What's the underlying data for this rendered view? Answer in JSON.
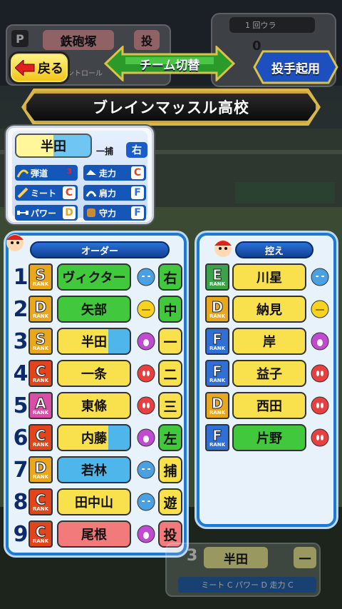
{
  "scoreboard_left": {
    "pos_badge": "P",
    "name": "鉄砲塚",
    "pos": "投",
    "sub": "コントロール"
  },
  "scoreboard_right": {
    "inning": "1 回ウラ",
    "score": "0"
  },
  "header": {
    "back_label": "戻る",
    "switch_label": "チーム切替",
    "pitcher_label": "投手起用",
    "school_name": "ブレインマッスル高校"
  },
  "status_card": {
    "name": "半田",
    "position": "一捕",
    "hand": "右",
    "stats": [
      {
        "label": "弾道",
        "value": "3",
        "icon": "trajectory-icon"
      },
      {
        "label": "走力",
        "value": "C",
        "icon": "shoe-icon"
      },
      {
        "label": "ミート",
        "value": "C",
        "icon": "bat-icon"
      },
      {
        "label": "肩力",
        "value": "F",
        "icon": "arm-icon"
      },
      {
        "label": "パワー",
        "value": "D",
        "icon": "dumbbell-icon"
      },
      {
        "label": "守力",
        "value": "F",
        "icon": "glove-icon"
      }
    ]
  },
  "order_panel": {
    "title": "オーダー",
    "rows": [
      {
        "num": "1",
        "rank": "S",
        "name": "ヴィクター",
        "pos": "右",
        "face": "sleepy",
        "name_color": "green"
      },
      {
        "num": "2",
        "rank": "D",
        "name": "矢部",
        "pos": "中",
        "face": "normal",
        "name_color": "green"
      },
      {
        "num": "3",
        "rank": "S",
        "name": "半田",
        "pos": "一",
        "face": "happy",
        "name_color": "yellowblue"
      },
      {
        "num": "4",
        "rank": "C",
        "name": "一条",
        "pos": "二",
        "face": "excited",
        "name_color": "yellow"
      },
      {
        "num": "5",
        "rank": "A",
        "name": "東條",
        "pos": "三",
        "face": "excited",
        "name_color": "yellow"
      },
      {
        "num": "6",
        "rank": "C",
        "name": "内藤",
        "pos": "左",
        "face": "happy",
        "name_color": "yellowblue"
      },
      {
        "num": "7",
        "rank": "D",
        "name": "若林",
        "pos": "捕",
        "face": "sleepy",
        "name_color": "blue"
      },
      {
        "num": "8",
        "rank": "C",
        "name": "田中山",
        "pos": "遊",
        "face": "sleepy",
        "name_color": "yellow"
      },
      {
        "num": "9",
        "rank": "C",
        "name": "尾根",
        "pos": "投",
        "face": "happy",
        "name_color": "red"
      }
    ]
  },
  "bench_panel": {
    "title": "控え",
    "rows": [
      {
        "rank": "E",
        "name": "川星",
        "face": "sleepy",
        "name_color": "yellow"
      },
      {
        "rank": "D",
        "name": "納見",
        "face": "normal",
        "name_color": "yellow"
      },
      {
        "rank": "F",
        "name": "岸",
        "face": "happy",
        "name_color": "yellow"
      },
      {
        "rank": "F",
        "name": "益子",
        "face": "excited",
        "name_color": "yellow"
      },
      {
        "rank": "D",
        "name": "西田",
        "face": "excited",
        "name_color": "yellow"
      },
      {
        "rank": "F",
        "name": "片野",
        "face": "excited",
        "name_color": "green"
      }
    ]
  },
  "bottom_card": {
    "num": "3",
    "name": "半田",
    "pos": "一",
    "stats": "ミート C パワー D 走力 C"
  },
  "colors": {
    "rank_S": "#e8a71c",
    "rank_A": "#d94fa8",
    "rank_C": "#e2451c",
    "rank_D": "#e8a71c",
    "rank_E": "#3aa34a",
    "rank_F": "#2f6fd6",
    "green": "#41c83c",
    "yellow": "#f9e14d",
    "blue": "#4fb6ec",
    "red": "#f37a7a"
  }
}
